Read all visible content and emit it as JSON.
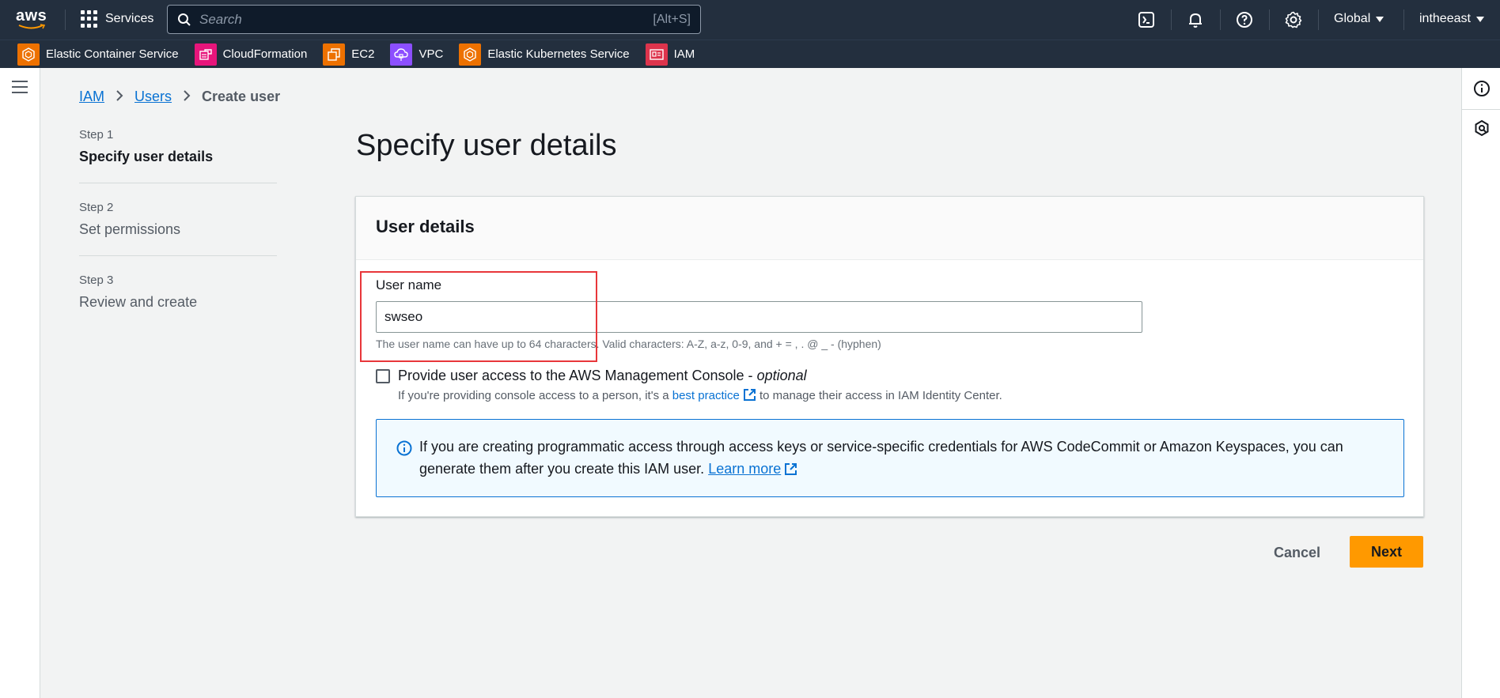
{
  "topnav": {
    "logo_text": "aws",
    "services_label": "Services",
    "search_placeholder": "Search",
    "search_shortcut": "[Alt+S]",
    "region_label": "Global",
    "account_label": "intheeast"
  },
  "favorites": [
    {
      "label": "Elastic Container Service",
      "color": "#ed7100"
    },
    {
      "label": "CloudFormation",
      "color": "#e7157b"
    },
    {
      "label": "EC2",
      "color": "#ed7100"
    },
    {
      "label": "VPC",
      "color": "#8c4fff"
    },
    {
      "label": "Elastic Kubernetes Service",
      "color": "#ed7100"
    },
    {
      "label": "IAM",
      "color": "#dd344c"
    }
  ],
  "breadcrumb": {
    "iam": "IAM",
    "users": "Users",
    "current": "Create user"
  },
  "steps": [
    {
      "num": "Step 1",
      "label": "Specify user details"
    },
    {
      "num": "Step 2",
      "label": "Set permissions"
    },
    {
      "num": "Step 3",
      "label": "Review and create"
    }
  ],
  "page": {
    "title": "Specify user details"
  },
  "card": {
    "title": "User details",
    "username_label": "User name",
    "username_value": "swseo",
    "username_hint": "The user name can have up to 64 characters. Valid characters: A-Z, a-z, 0-9, and + = , . @ _ - (hyphen)",
    "console_label": "Provide user access to the AWS Management Console - ",
    "console_optional": "optional",
    "console_desc_pre": "If you're providing console access to a person, it's a ",
    "console_desc_link": "best practice",
    "console_desc_post": " to manage their access in IAM Identity Center.",
    "info_text": "If you are creating programmatic access through access keys or service-specific credentials for AWS CodeCommit or Amazon Keyspaces, you can generate them after you create this IAM user. ",
    "info_link": "Learn more"
  },
  "actions": {
    "cancel": "Cancel",
    "next": "Next"
  },
  "colors": {
    "accent": "#ff9900",
    "link": "#0972d3",
    "nav_bg": "#232f3e",
    "highlight": "#e8363a"
  }
}
